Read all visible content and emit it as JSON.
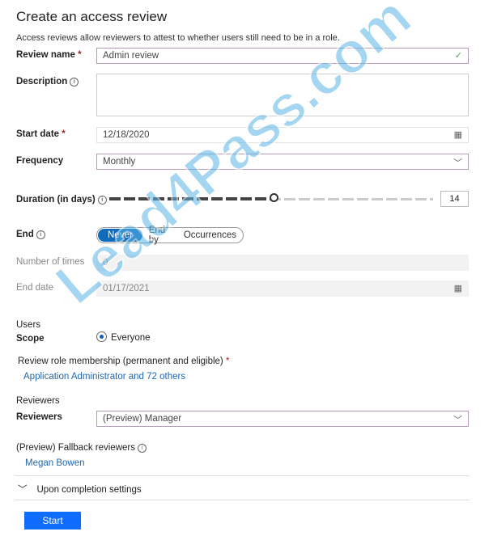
{
  "title": "Create an access review",
  "subtitle": "Access reviews allow reviewers to attest to whether users still need to be in a role.",
  "review_name": {
    "label": "Review name",
    "required": "*",
    "value": "Admin review"
  },
  "description": {
    "label": "Description",
    "value": ""
  },
  "start_date": {
    "label": "Start date",
    "required": "*",
    "value": "12/18/2020"
  },
  "frequency": {
    "label": "Frequency",
    "value": "Monthly"
  },
  "duration": {
    "label": "Duration (in days)",
    "value": "14"
  },
  "end": {
    "label": "End",
    "options": [
      "Never",
      "End by",
      "Occurrences"
    ],
    "selected": "Never"
  },
  "number_of_times": {
    "label": "Number of times",
    "value": "0"
  },
  "end_date": {
    "label": "End date",
    "value": "01/17/2021"
  },
  "users": {
    "heading": "Users",
    "scope_label": "Scope",
    "scope_value": "Everyone"
  },
  "role_membership": {
    "label": "Review role membership (permanent and eligible)",
    "required": "*",
    "link": "Application Administrator and 72 others"
  },
  "reviewers": {
    "heading": "Reviewers",
    "label": "Reviewers",
    "value": "(Preview) Manager"
  },
  "fallback": {
    "label": "(Preview) Fallback reviewers",
    "link": "Megan Bowen"
  },
  "completion": {
    "label": "Upon completion settings"
  },
  "start_button": "Start",
  "watermark": "Lead4Pass.com",
  "colors": {
    "accent": "#0f6cbd",
    "link": "#2466a8",
    "button": "#0f6cfd"
  }
}
